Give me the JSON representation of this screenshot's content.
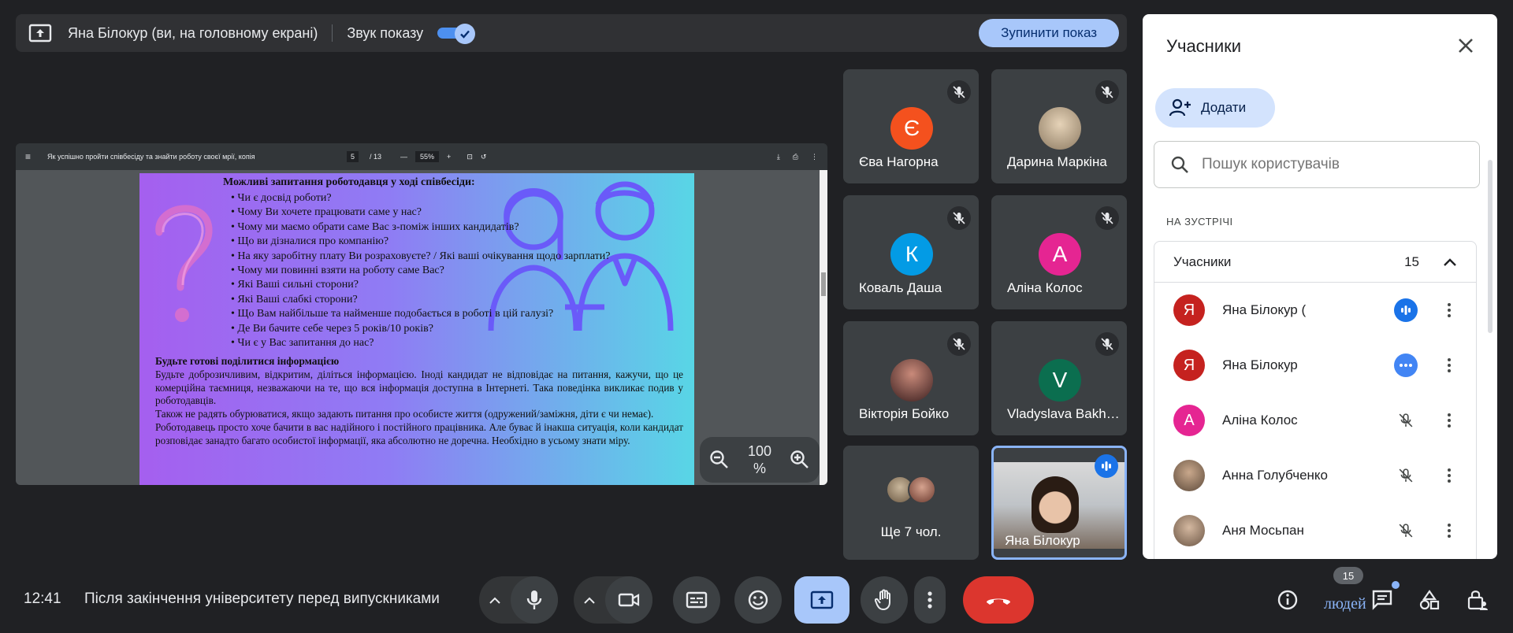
{
  "topbar": {
    "presenter": "Яна Білокур (ви, на головному екрані)",
    "sound_label": "Звук показу",
    "stop_label": "Зупинити показ"
  },
  "pdf": {
    "filename": "Як успішно пройти співбесіду та знайти роботу своєї мрії, копія",
    "page": "5",
    "total": "/ 13",
    "zoom": "55%"
  },
  "slide": {
    "heading": "Можливі запитання роботодавця у ході співбесіди:",
    "questions": [
      "Чи є досвід роботи?",
      "Чому Ви хочете працювати саме у нас?",
      "Чому ми маємо обрати саме Вас з-поміж інших кандидатів?",
      "Що ви дізналися про компанію?",
      "На яку заробітну плату Ви розраховуєте? / Які ваші очікування щодо зарплати?",
      "Чому ми повинні взяти на роботу саме Вас?",
      "Які Ваші сильні сторони?",
      "Які Ваші слабкі сторони?",
      "Що Вам найбільше та найменше подобається в роботі в цій галузі?",
      "Де Ви бачите себе через 5 років/10 років?",
      "Чи є у Вас запитання до нас?"
    ],
    "heading2": "Будьте готові поділитися інформацією",
    "para1": "Будьте доброзичливим, відкритим, діліться інформацією. Іноді кандидат не відповідає на питання, кажучи, що це комерційна таємниця, незважаючи на те, що вся інформація доступна в Інтернеті. Така поведінка викликає подив у роботодавців.",
    "para2": "Також не радять обурюватися, якщо задають питання про особисте життя (одружений/заміжня, діти є чи немає).",
    "para3": "Роботодавець просто хоче бачити в вас надійного і постійного працівника. Але буває й інакша ситуація, коли кандидат розповідає занадто багато особистої інформації, яка абсолютно не доречна. Необхідно в усьому знати міру."
  },
  "zoom_control": {
    "value": "100",
    "unit": "%"
  },
  "tiles": [
    {
      "name": "Єва Нагорна",
      "initial": "Є",
      "color": "#f4511e"
    },
    {
      "name": "Дарина Маркіна",
      "initial": "",
      "color": "#c9b79c"
    },
    {
      "name": "Коваль Даша",
      "initial": "К",
      "color": "#039be5"
    },
    {
      "name": "Аліна Колос",
      "initial": "А",
      "color": "#e52592"
    },
    {
      "name": "Вікторія Бойко",
      "initial": "",
      "color": "#7b3b3b"
    },
    {
      "name": "Vladyslava Bakhmut",
      "initial": "V",
      "color": "#0b6e4f"
    },
    {
      "name": "Ще 7 чол."
    },
    {
      "name": "Яна Білокур"
    }
  ],
  "panel": {
    "title": "Учасники",
    "add_label": "Додати",
    "search_placeholder": "Пошук користувачів",
    "section": "НА ЗУСТРІЧІ",
    "list_header": "Учасники",
    "count": "15",
    "people": [
      {
        "name": "Яна Білокур (",
        "initial": "Я",
        "color": "#c5221f"
      },
      {
        "name": "Яна Білокур",
        "initial": "Я",
        "color": "#c5221f"
      },
      {
        "name": "Аліна Колос",
        "initial": "А",
        "color": "#e52592"
      },
      {
        "name": "Анна Голубченко",
        "initial": "",
        "color": "#8d6e63"
      },
      {
        "name": "Аня Мосьпан",
        "initial": "",
        "color": "#a1887f"
      }
    ]
  },
  "bottom": {
    "time": "12:41",
    "meeting": "Після закінчення університету перед випускниками",
    "people_badge": "15",
    "people_label": "людей"
  }
}
